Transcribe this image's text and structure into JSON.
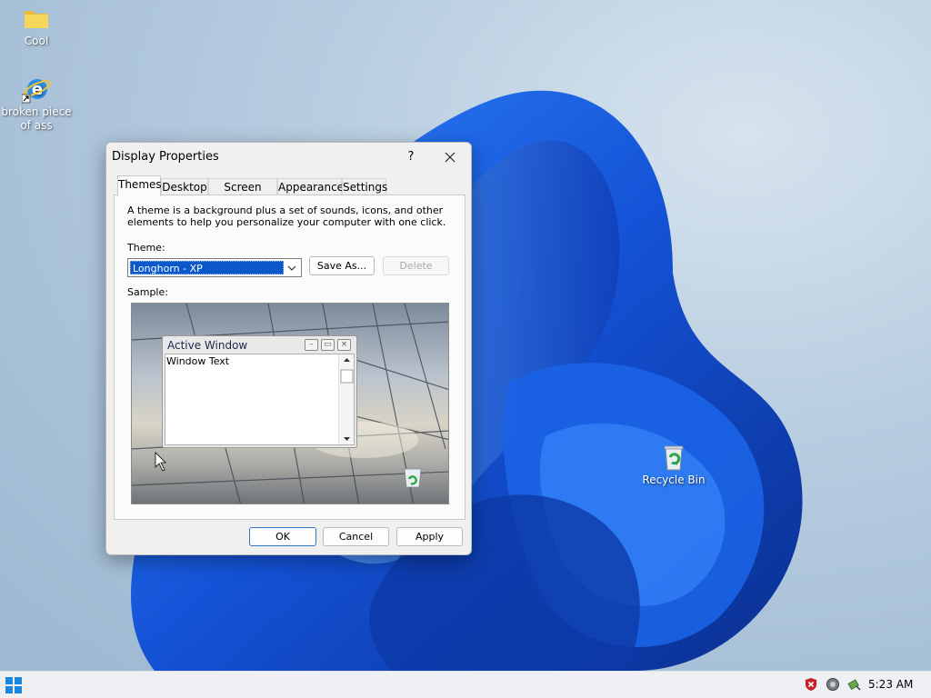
{
  "desktop": {
    "icons": [
      {
        "label": "Cool",
        "icon": "folder-icon"
      },
      {
        "label": "broken piece of ass",
        "icon": "internet-explorer-icon"
      },
      {
        "label": "Recycle Bin",
        "icon": "recycle-bin-icon"
      }
    ]
  },
  "dialog": {
    "title": "Display Properties",
    "help_label": "?",
    "tabs": [
      {
        "label": "Themes",
        "active": true
      },
      {
        "label": "Desktop"
      },
      {
        "label": "Screen Saver"
      },
      {
        "label": "Appearance"
      },
      {
        "label": "Settings"
      }
    ],
    "description": "A theme is a background plus a set of sounds, icons, and other elements to help you personalize your computer with one click.",
    "theme_label": "Theme:",
    "theme_value": "Longhorn - XP",
    "save_as_label": "Save As...",
    "delete_label": "Delete",
    "sample_label": "Sample:",
    "sample": {
      "window_title": "Active Window",
      "window_text": "Window Text"
    },
    "ok_label": "OK",
    "cancel_label": "Cancel",
    "apply_label": "Apply"
  },
  "taskbar": {
    "time": "5:23 AM",
    "tray_icons": [
      "security-shield-icon",
      "network-icon",
      "safely-remove-hardware-icon"
    ]
  },
  "colors": {
    "selection": "#0a58c9",
    "wallpaper_bloom": "#1a5bd8",
    "default_button_border": "#2f76c7"
  }
}
